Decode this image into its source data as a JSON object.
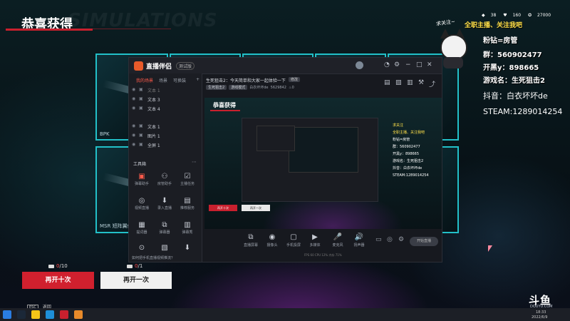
{
  "page": {
    "title": "恭喜获得",
    "watermark": "SIMULATIONS"
  },
  "cards": [
    {
      "label": "BPK"
    },
    {
      "label": ""
    },
    {
      "label": ""
    },
    {
      "label": ""
    },
    {
      "label": ""
    },
    {
      "label": "MSR 短阵翼偷"
    },
    {
      "label": ""
    },
    {
      "label": ""
    },
    {
      "label": ""
    },
    {
      "label": ""
    }
  ],
  "software": {
    "app_name": "直播伴侣",
    "version_badge": "测试版",
    "tabs": [
      "我的场景",
      "场景",
      "可换装"
    ],
    "sources": [
      {
        "label": "文本 1"
      },
      {
        "label": "文本 3"
      },
      {
        "label": "文本 4"
      },
      {
        "label": "文本 1"
      },
      {
        "label": "图片 1"
      },
      {
        "label": "全屏 1"
      }
    ],
    "toolbox_label": "工具箱",
    "tools": [
      {
        "label": "弹幕助手",
        "icon": "▣"
      },
      {
        "label": "房管助手",
        "icon": "⚇"
      },
      {
        "label": "主播任务",
        "icon": "☑"
      },
      {
        "label": "视频直播",
        "icon": "◎"
      },
      {
        "label": "录入直播",
        "icon": "⬇"
      },
      {
        "label": "推荐服务",
        "icon": "▤"
      },
      {
        "label": "提词器",
        "icon": "▦"
      },
      {
        "label": "弹幕器",
        "icon": "⧉"
      },
      {
        "label": "弹幕秀",
        "icon": "▥"
      },
      {
        "label": "",
        "icon": "⊙"
      },
      {
        "label": "",
        "icon": "▧"
      },
      {
        "label": "",
        "icon": "⬇"
      }
    ],
    "footer_tip": "如何把手机直播视频推流？",
    "stream_title": "生死狙击2：今天简单和大家一起体验一下",
    "stream_tag": "修改",
    "stream_meta": [
      "生死狙击2",
      "游戏模式",
      "白衣坏坏de",
      "5629842",
      "0"
    ],
    "bottom_tools": [
      {
        "label": "直播屏幕",
        "icon": "⧉"
      },
      {
        "label": "摄像头",
        "icon": "◉"
      },
      {
        "label": "手机投屏",
        "icon": "▢"
      },
      {
        "label": "多媒体",
        "icon": "▶"
      },
      {
        "label": "麦克风",
        "icon": "🎤"
      },
      {
        "label": "扬声器",
        "icon": "🔊"
      }
    ],
    "start_label": "开始直播",
    "status_line": "FPS 60   CPU 12%   内存 71%"
  },
  "preview": {
    "title": "恭喜获得",
    "btn_ten": "再开十次",
    "btn_one": "再开一次",
    "info": [
      "求关注",
      "全职主播、关注我吧",
      "粉钻=房管",
      "群：560902477",
      "开黑y：898665",
      "游戏名：生死狙击2",
      "抖音：白衣坏坏de",
      "STEAM:1289014254"
    ]
  },
  "overlay": {
    "cat_tag": "求关注~",
    "headline": "全职主播、关注我吧",
    "stats": [
      "38",
      "160",
      "27000"
    ],
    "lines": [
      {
        "text": "粉钻=房管"
      },
      {
        "text": "群：560902477"
      },
      {
        "text": "开黑y：898665"
      },
      {
        "text": "游戏名：生死狙击2"
      }
    ],
    "big_lines": [
      {
        "text": "抖音：白衣坏坏de"
      },
      {
        "text": "STEAM:1289014254"
      }
    ]
  },
  "actions": {
    "draw_ten": "再开十次",
    "draw_one": "再开一次",
    "count_ten_used": "0",
    "count_ten_total": "/10",
    "count_one_used": "0",
    "count_one_total": "/1",
    "esc_key": "ESC",
    "esc_label": "返回"
  },
  "brand": {
    "logo": "斗鱼",
    "sub": "DOUYU.COM",
    "time": "18:33",
    "date": "2022/6/9"
  },
  "colors": {
    "accent_red": "#c8202e",
    "card_border": "#22c0c8",
    "highlight_yellow": "#ffe14a"
  }
}
